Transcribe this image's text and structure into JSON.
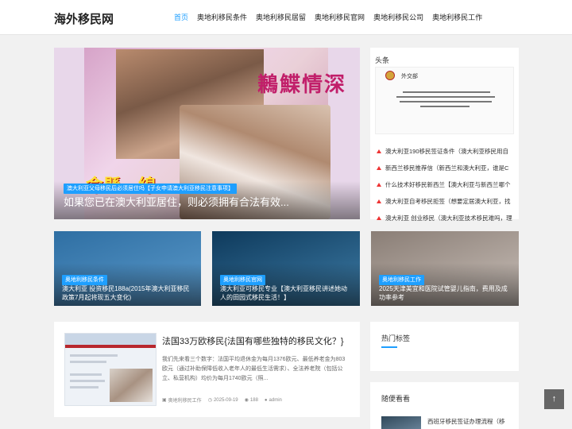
{
  "site": {
    "logo": "海外移民网"
  },
  "nav": [
    {
      "label": "首页",
      "active": true
    },
    {
      "label": "奥地利移民条件",
      "active": false
    },
    {
      "label": "奥地利移民居留",
      "active": false
    },
    {
      "label": "奥地利移民官网",
      "active": false
    },
    {
      "label": "奥地利移民公司",
      "active": false
    },
    {
      "label": "奥地利移民工作",
      "active": false
    }
  ],
  "hero": {
    "art_title": "鶼鰈情深",
    "art_sub": "命懸一線",
    "tag": "澳大利亚父母移民后必须居住吗【子女申请澳大利亚移民注意事项】",
    "caption": "如果您已在澳大利亚居住，则必须拥有合法有效..."
  },
  "cards": [
    {
      "tag": "奥地利移民条件",
      "caption": "澳大利亚 投资移民188a(2015年澳大利亚移民政策7月起将现五大变化)",
      "colors": [
        "#2f6fa3",
        "#5b9acb"
      ]
    },
    {
      "tag": "奥地利移民官网",
      "caption": "澳大利亚可移民专业【澳大利亚移民讲述她动人的田园式移民生活！】",
      "colors": [
        "#0e3a5c",
        "#3e7ca6"
      ]
    },
    {
      "tag": "奥地利移民工作",
      "caption": "2025天津美宜和医院试管婴儿指南，费用及成功率参考",
      "colors": [
        "#8a7e76",
        "#c9bfb8"
      ]
    }
  ],
  "article": {
    "title": "法国33万欧移民{法国有哪些独特的移民文化？}",
    "excerpt": "我们先来看三个数字：法国平均退休金为每月1376欧元、最低养老金为803欧元（通过补助保障低收入老年人的最低生活需求）、全法养老院（包括公立、私营机构）均价为每月1740欧元（照...",
    "category": "奥地利移民工作",
    "date": "2025-09-19",
    "views": "188",
    "author": "admin"
  },
  "sidebar": {
    "headlines_title": "头条",
    "headline_image_text": "外交部",
    "headlines": [
      "澳大利亚190移民签证条件（澳大利亚移民用自",
      "新西兰移民推荐信（新西兰和澳大利亚，谁是C",
      "什么技术好移民新西兰【澳大利亚与新西兰哪个",
      "澳大利亚自考移民拒签（想要定居澳大利亚，找",
      "澳大利亚 创业移民（澳大利亚技术移民难吗，理"
    ],
    "hot_tags_title": "热门标签",
    "random_title": "随便看看",
    "random_items": [
      "西班牙移民签证办理流程（移"
    ]
  },
  "back_to_top": "↑"
}
